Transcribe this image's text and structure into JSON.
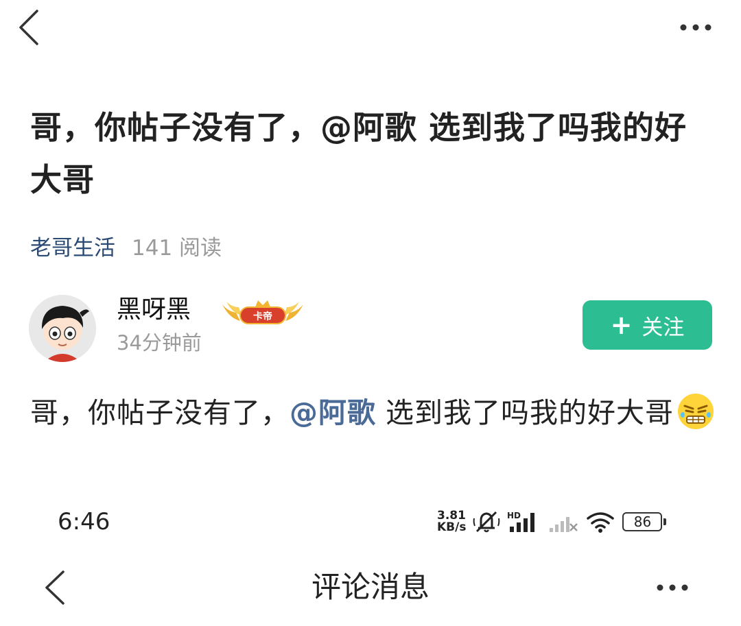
{
  "post": {
    "title": "哥，你帖子没有了，@阿歌 选到我了吗我的好大哥",
    "channel": "老哥生活",
    "read_count": "141 阅读"
  },
  "author": {
    "name": "黑呀黑",
    "badge_text": "卡帝",
    "time": "34分钟前",
    "follow_label": "关注",
    "follow_plus": "+"
  },
  "content": {
    "before_mention": "哥，你帖子没有了，",
    "mention": "@阿歌",
    "after_mention": " 选到我了吗我的好大哥",
    "emoji": "grimacing-face"
  },
  "status_bar": {
    "time": "6:46",
    "speed_value": "3.81",
    "speed_unit": "KB/s",
    "hd_label": "HD",
    "battery": "86"
  },
  "second_page": {
    "title": "评论消息"
  },
  "colors": {
    "accent": "#2dbd92",
    "channel": "#2a4a73",
    "mention": "#4a6a97",
    "muted": "#9a9a9a"
  }
}
